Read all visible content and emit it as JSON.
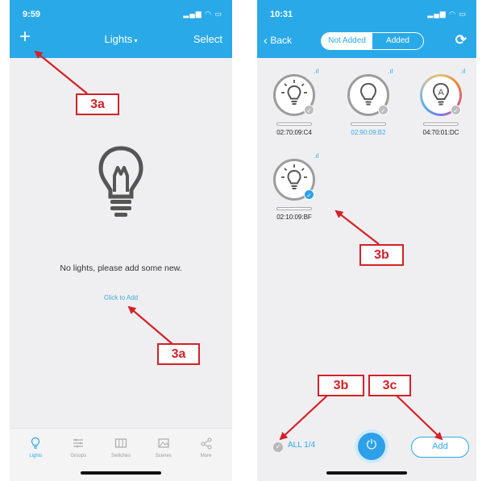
{
  "left_screen": {
    "status_time": "9:59",
    "title": "Lights",
    "select_label": "Select",
    "empty_message": "No lights, please add some new.",
    "click_to_add": "Click to Add",
    "tabs": [
      {
        "label": "Lights",
        "icon": "bulb-icon",
        "active": true
      },
      {
        "label": "Groups",
        "icon": "groups-icon",
        "active": false
      },
      {
        "label": "Switches",
        "icon": "switch-icon",
        "active": false
      },
      {
        "label": "Scenes",
        "icon": "scene-icon",
        "active": false
      },
      {
        "label": "More",
        "icon": "share-icon",
        "active": false
      }
    ]
  },
  "right_screen": {
    "status_time": "10:31",
    "back_label": "Back",
    "segment_not_added": "Not Added",
    "segment_added": "Added",
    "devices": [
      {
        "mac": "02:70:09:C4",
        "type": "bulb-rays",
        "checked": false,
        "highlight": false
      },
      {
        "mac": "02:90:09:B2",
        "type": "bulb",
        "checked": false,
        "highlight": true
      },
      {
        "mac": "04:70:01:DC",
        "type": "letter-a",
        "checked": false,
        "highlight": false
      },
      {
        "mac": "02:10:09:BF",
        "type": "bulb-rays",
        "checked": true,
        "highlight": false
      }
    ],
    "all_label": "ALL 1/4",
    "add_label": "Add"
  },
  "callouts": {
    "c1": "3a",
    "c2": "3a",
    "c3": "3b",
    "c4": "3b",
    "c5": "3c"
  },
  "colors": {
    "accent": "#2aa9e9",
    "callout_red": "#d42128"
  }
}
